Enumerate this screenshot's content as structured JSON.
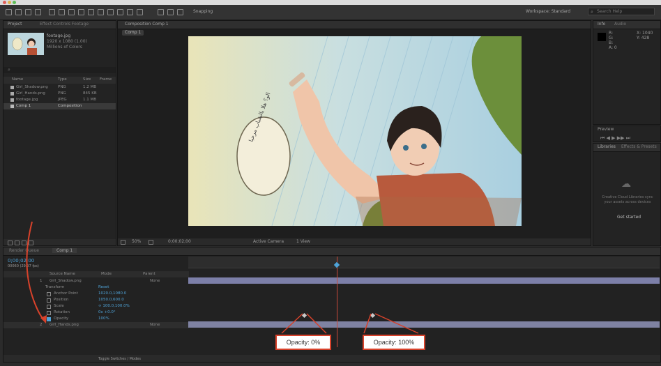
{
  "app": {
    "workspace_label": "Workspace: Standard",
    "search_placeholder": "Search Help"
  },
  "toolbar": {
    "snapping_label": "Snapping"
  },
  "project_panel": {
    "tab": "Project",
    "tab2": "Effect Controls Footage",
    "asset_name": "footage.jpg",
    "asset_info1": "1920 x 1080 (1.00)",
    "asset_info2": "Millions of Colors",
    "columns": [
      "Name",
      "Type",
      "Size",
      "Frame"
    ],
    "items": [
      {
        "name": "Girl_Shadow.png",
        "type": "PNG",
        "size": "1.2 MB"
      },
      {
        "name": "Girl_Hands.png",
        "type": "PNG",
        "size": "845 KB"
      },
      {
        "name": "footage.jpg",
        "type": "JPEG",
        "size": "1.1 MB"
      },
      {
        "name": "Comp 1",
        "type": "Composition",
        "size": ""
      }
    ]
  },
  "composition_panel": {
    "tab": "Composition Comp 1",
    "comp_chip": "Comp 1",
    "zoom": "50%",
    "timecode": "0;00;02;00",
    "view": "Active Camera",
    "views": "1 View"
  },
  "info_panel": {
    "tab1": "Info",
    "tab2": "Audio",
    "values": [
      "R:",
      "G:",
      "B:",
      "A: 0"
    ],
    "xy": [
      "X: 1040",
      "Y: 428"
    ]
  },
  "preview_panel": {
    "tab": "Preview"
  },
  "libraries_panel": {
    "tab1": "Libraries",
    "tab2": "Effects & Presets",
    "message": "Creative Cloud Libraries sync your assets across devices",
    "button": "Get started"
  },
  "timeline": {
    "tab_render": "Render Queue",
    "tab_comp": "Comp 1",
    "timecode": "0;00;02;00",
    "fps": "00060 (29.97 fps)",
    "col_source": "Source Name",
    "col_mode": "Mode",
    "col_parent": "Parent",
    "layers": [
      {
        "num": "1",
        "name": "Girl_Shadow.png",
        "parent": "None"
      },
      {
        "num": "2",
        "name": "Girl_Hands.png",
        "parent": "None"
      }
    ],
    "transform": "Transform",
    "reset": "Reset",
    "props": [
      {
        "name": "Anchor Point",
        "value": "1020.0,1080.0"
      },
      {
        "name": "Position",
        "value": "1050.0,600.0"
      },
      {
        "name": "Scale",
        "value": "∞ 100.0,100.0%"
      },
      {
        "name": "Rotation",
        "value": "0x +0.0°"
      },
      {
        "name": "Opacity",
        "value": "100%"
      }
    ]
  },
  "callouts": {
    "left": "Opacity: 0%",
    "right": "Opacity: 100%"
  },
  "bubble_text": "الو؟ هلا بالشباب مرحبا",
  "status": {
    "toggle": "Toggle Switches / Modes"
  }
}
